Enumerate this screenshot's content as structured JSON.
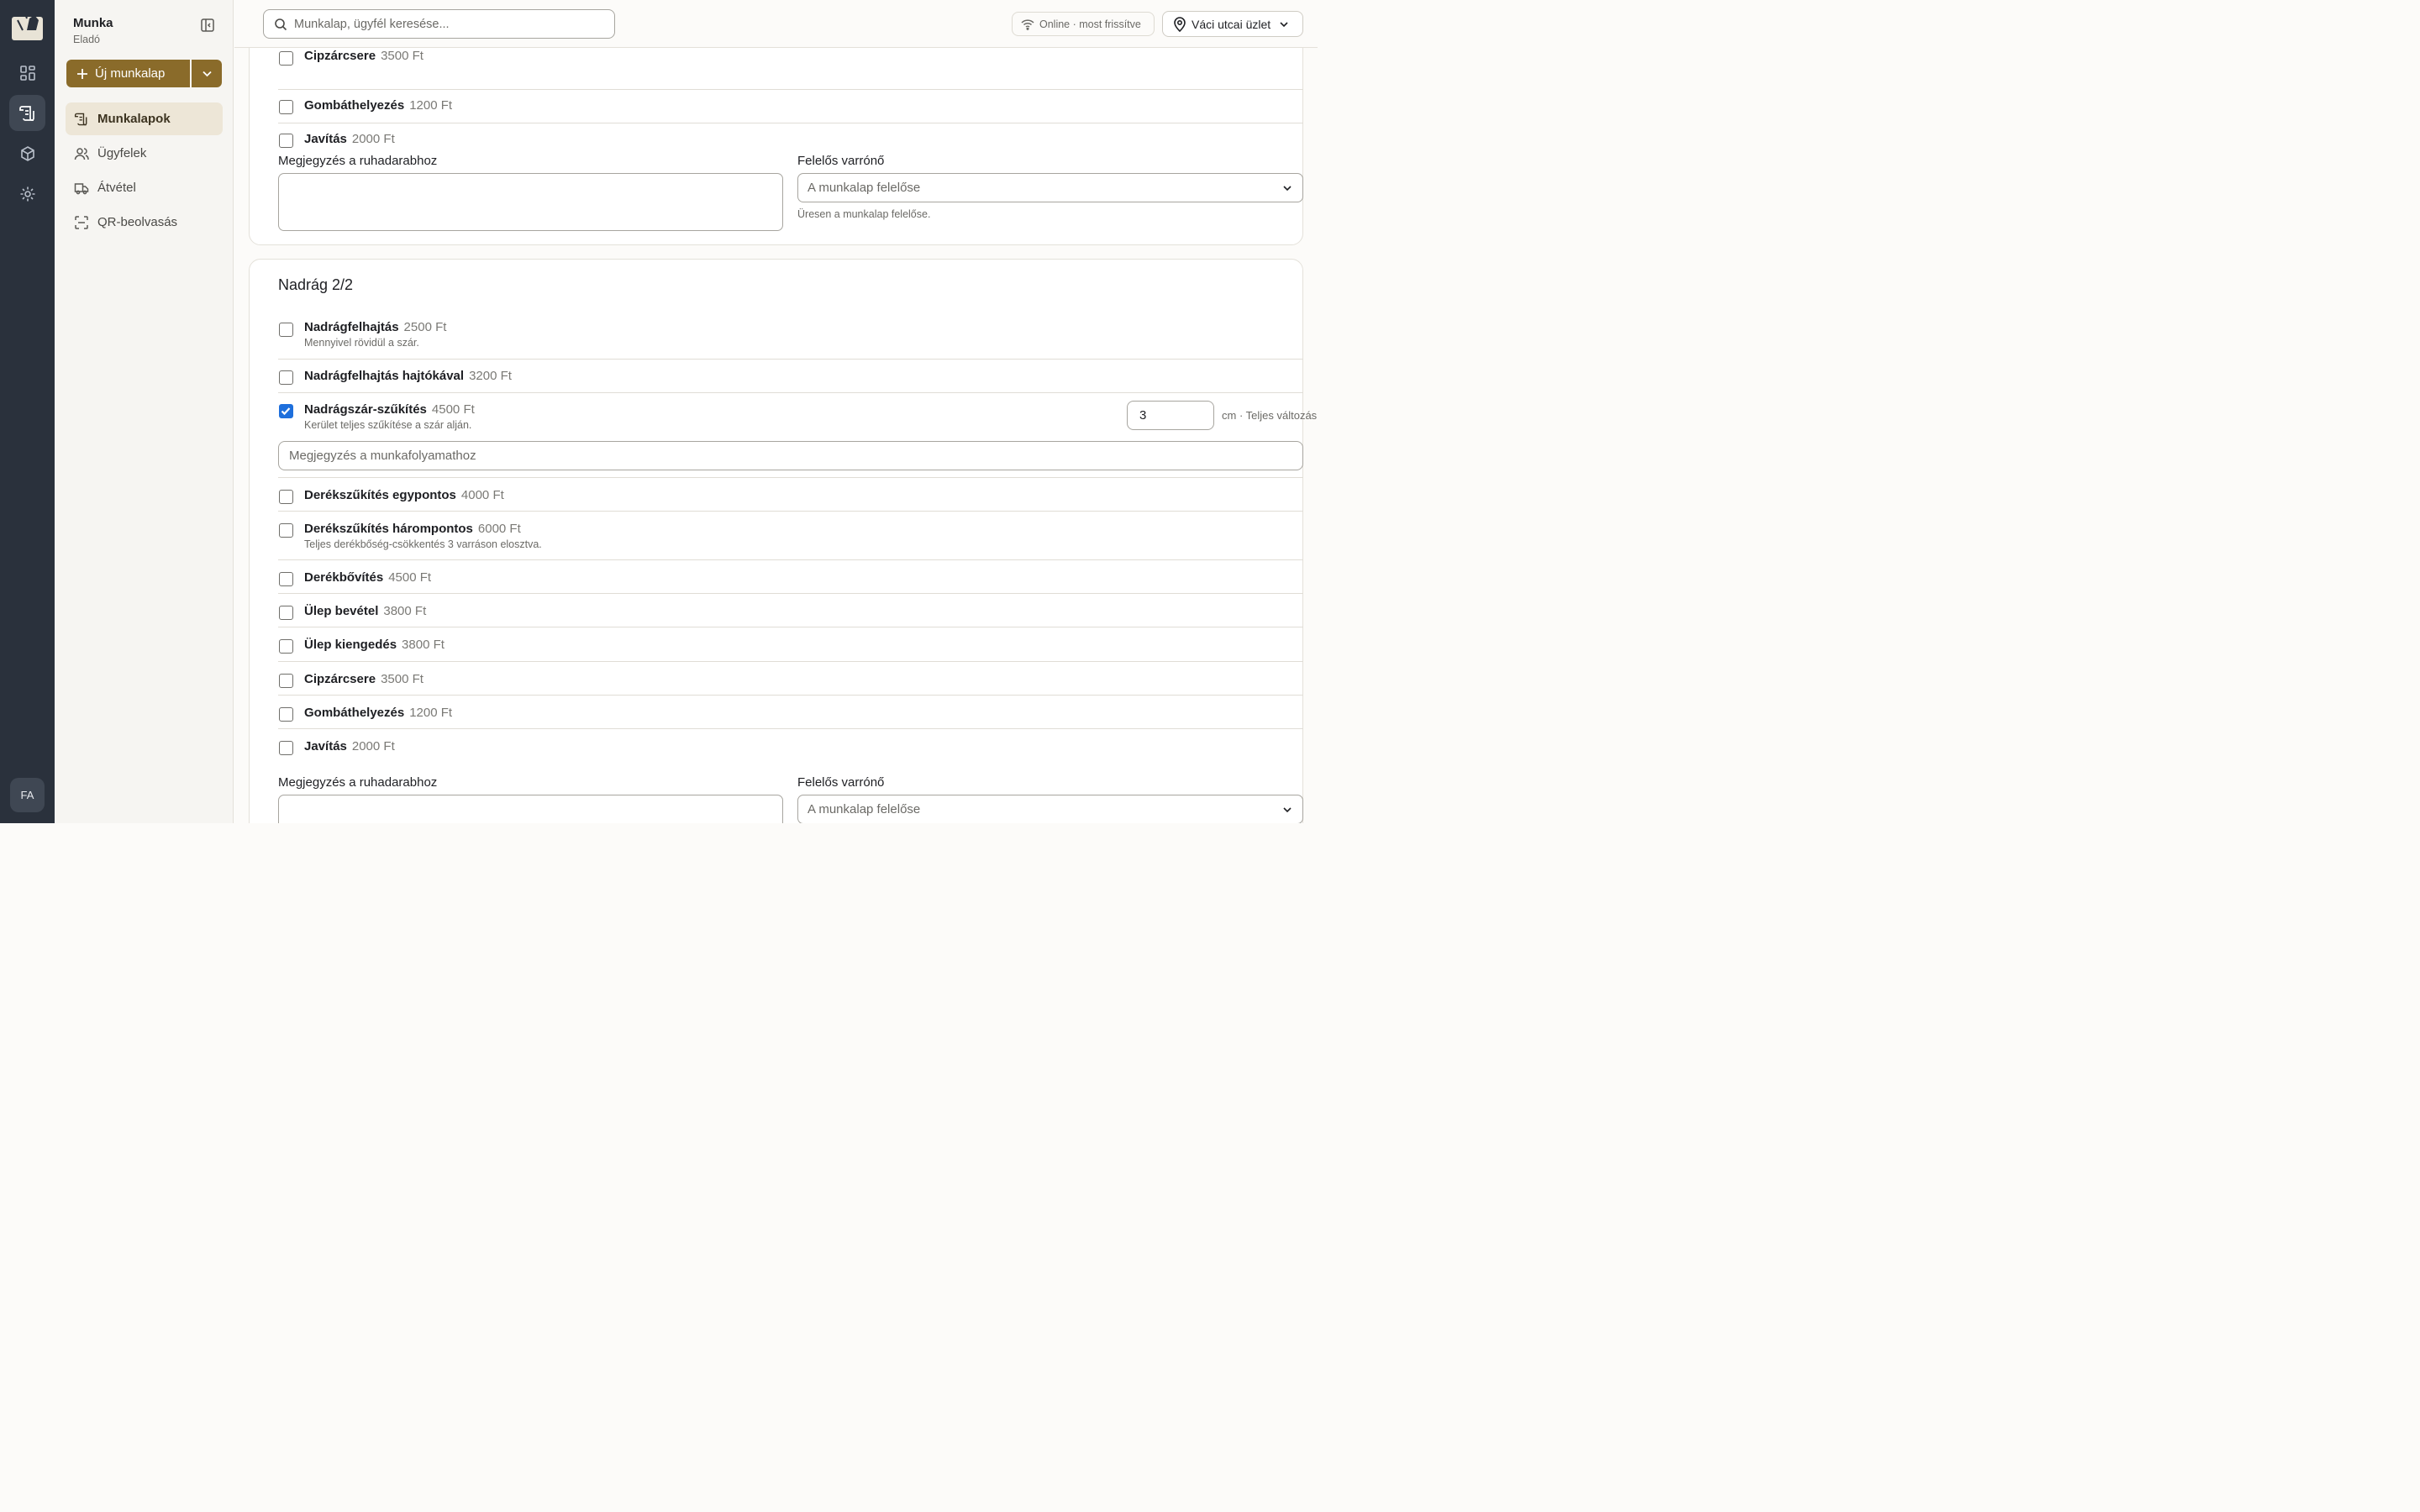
{
  "rail": {
    "avatar": "FA"
  },
  "sidebar": {
    "title": "Munka",
    "subtitle": "Eladó",
    "new_button": "Új munkalap",
    "items": [
      {
        "label": "Munkalapok",
        "icon": "worksheet-icon",
        "active": true
      },
      {
        "label": "Ügyfelek",
        "icon": "users-icon",
        "active": false
      },
      {
        "label": "Átvétel",
        "icon": "truck-icon",
        "active": false
      },
      {
        "label": "QR-beolvasás",
        "icon": "qr-scan-icon",
        "active": false
      }
    ]
  },
  "topbar": {
    "search_placeholder": "Munkalap, ügyfél keresése...",
    "status": "Online · most frissítve",
    "store": "Váci utcai üzlet"
  },
  "card1": {
    "items": [
      {
        "name": "Cipzárcsere",
        "price": "3500 Ft"
      },
      {
        "name": "Gombáthelyezés",
        "price": "1200 Ft"
      },
      {
        "name": "Javítás",
        "price": "2000 Ft"
      }
    ],
    "note_label": "Megjegyzés a ruhadarabhoz",
    "tailor_label": "Felelős varrónő",
    "tailor_placeholder": "A munkalap felelőse",
    "tailor_hint": "Üresen a munkalap felelőse."
  },
  "card2": {
    "title": "Nadrág 2/2",
    "items": [
      {
        "name": "Nadrágfelhajtás",
        "price": "2500 Ft",
        "desc": "Mennyivel rövidül a szár.",
        "checked": false
      },
      {
        "name": "Nadrágfelhajtás hajtókával",
        "price": "3200 Ft",
        "desc": "",
        "checked": false
      },
      {
        "name": "Nadrágszár-szűkítés",
        "price": "4500 Ft",
        "desc": "Kerület teljes szűkítése a szár alján.",
        "checked": true,
        "value": "3",
        "unit": "cm · Teljes változás",
        "workflow_placeholder": "Megjegyzés a munkafolyamathoz"
      },
      {
        "name": "Derékszűkítés egypontos",
        "price": "4000 Ft",
        "desc": "",
        "checked": false
      },
      {
        "name": "Derékszűkítés hárompontos",
        "price": "6000 Ft",
        "desc": "Teljes derékbőség-csökkentés 3 varráson elosztva.",
        "checked": false
      },
      {
        "name": "Derékbővítés",
        "price": "4500 Ft",
        "desc": "",
        "checked": false
      },
      {
        "name": "Ülep bevétel",
        "price": "3800 Ft",
        "desc": "",
        "checked": false
      },
      {
        "name": "Ülep kiengedés",
        "price": "3800 Ft",
        "desc": "",
        "checked": false
      },
      {
        "name": "Cipzárcsere",
        "price": "3500 Ft",
        "desc": "",
        "checked": false
      },
      {
        "name": "Gombáthelyezés",
        "price": "1200 Ft",
        "desc": "",
        "checked": false
      },
      {
        "name": "Javítás",
        "price": "2000 Ft",
        "desc": "",
        "checked": false
      }
    ],
    "note_label": "Megjegyzés a ruhadarabhoz",
    "tailor_label": "Felelős varrónő",
    "tailor_placeholder": "A munkalap felelőse"
  },
  "colors": {
    "accent": "#8a6b2a",
    "rail": "#2a313c",
    "checkbox": "#1e6fdc"
  }
}
